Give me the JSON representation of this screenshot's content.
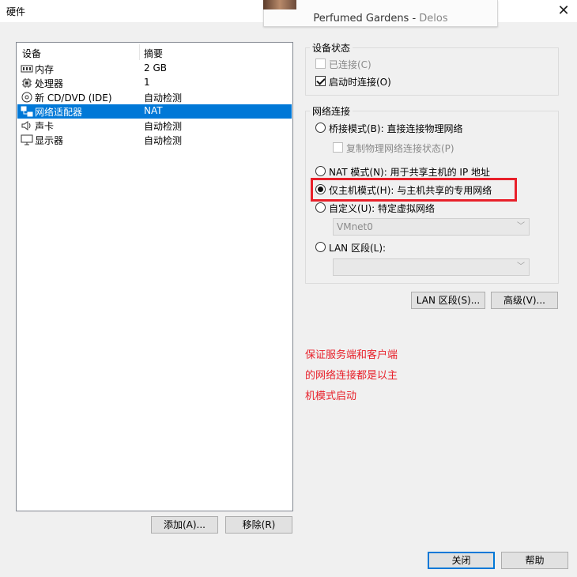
{
  "window": {
    "title": "硬件",
    "close_glyph": "✕"
  },
  "media_popup": {
    "track": "Perfumed Gardens",
    "separator": " - ",
    "artist": "Delos"
  },
  "device_list": {
    "columns": {
      "device": "设备",
      "summary": "摘要"
    },
    "rows": [
      {
        "name": "内存",
        "summary": "2 GB",
        "icon": "memory-icon"
      },
      {
        "name": "处理器",
        "summary": "1",
        "icon": "processor-icon"
      },
      {
        "name": "新 CD/DVD (IDE)",
        "summary": "自动检测",
        "icon": "cd-dvd-icon"
      },
      {
        "name": "网络适配器",
        "summary": "NAT",
        "icon": "network-adapter-icon",
        "selected": true
      },
      {
        "name": "声卡",
        "summary": "自动检测",
        "icon": "sound-card-icon"
      },
      {
        "name": "显示器",
        "summary": "自动检测",
        "icon": "display-icon"
      }
    ]
  },
  "buttons": {
    "add": "添加(A)...",
    "remove": "移除(R)",
    "lan_segments": "LAN 区段(S)...",
    "advanced": "高级(V)...",
    "close": "关闭",
    "help": "帮助"
  },
  "device_status": {
    "title": "设备状态",
    "connected": {
      "label": "已连接(C)",
      "checked": false,
      "disabled": true
    },
    "connect_at_power_on": {
      "label": "启动时连接(O)",
      "checked": true
    }
  },
  "network_connection": {
    "title": "网络连接",
    "bridged": "桥接模式(B): 直接连接物理网络",
    "replicate_state": "复制物理网络连接状态(P)",
    "nat": "NAT 模式(N): 用于共享主机的 IP 地址",
    "host_only": "仅主机模式(H): 与主机共享的专用网络",
    "custom": "自定义(U): 特定虚拟网络",
    "custom_value": "VMnet0",
    "lan_segment": "LAN 区段(L):",
    "lan_segment_value": "",
    "selected": "host_only"
  },
  "annotation": {
    "lines": [
      "保证服务端和客户端",
      "的网络连接都是以主",
      "机模式启动"
    ],
    "color": "#e8202a"
  }
}
